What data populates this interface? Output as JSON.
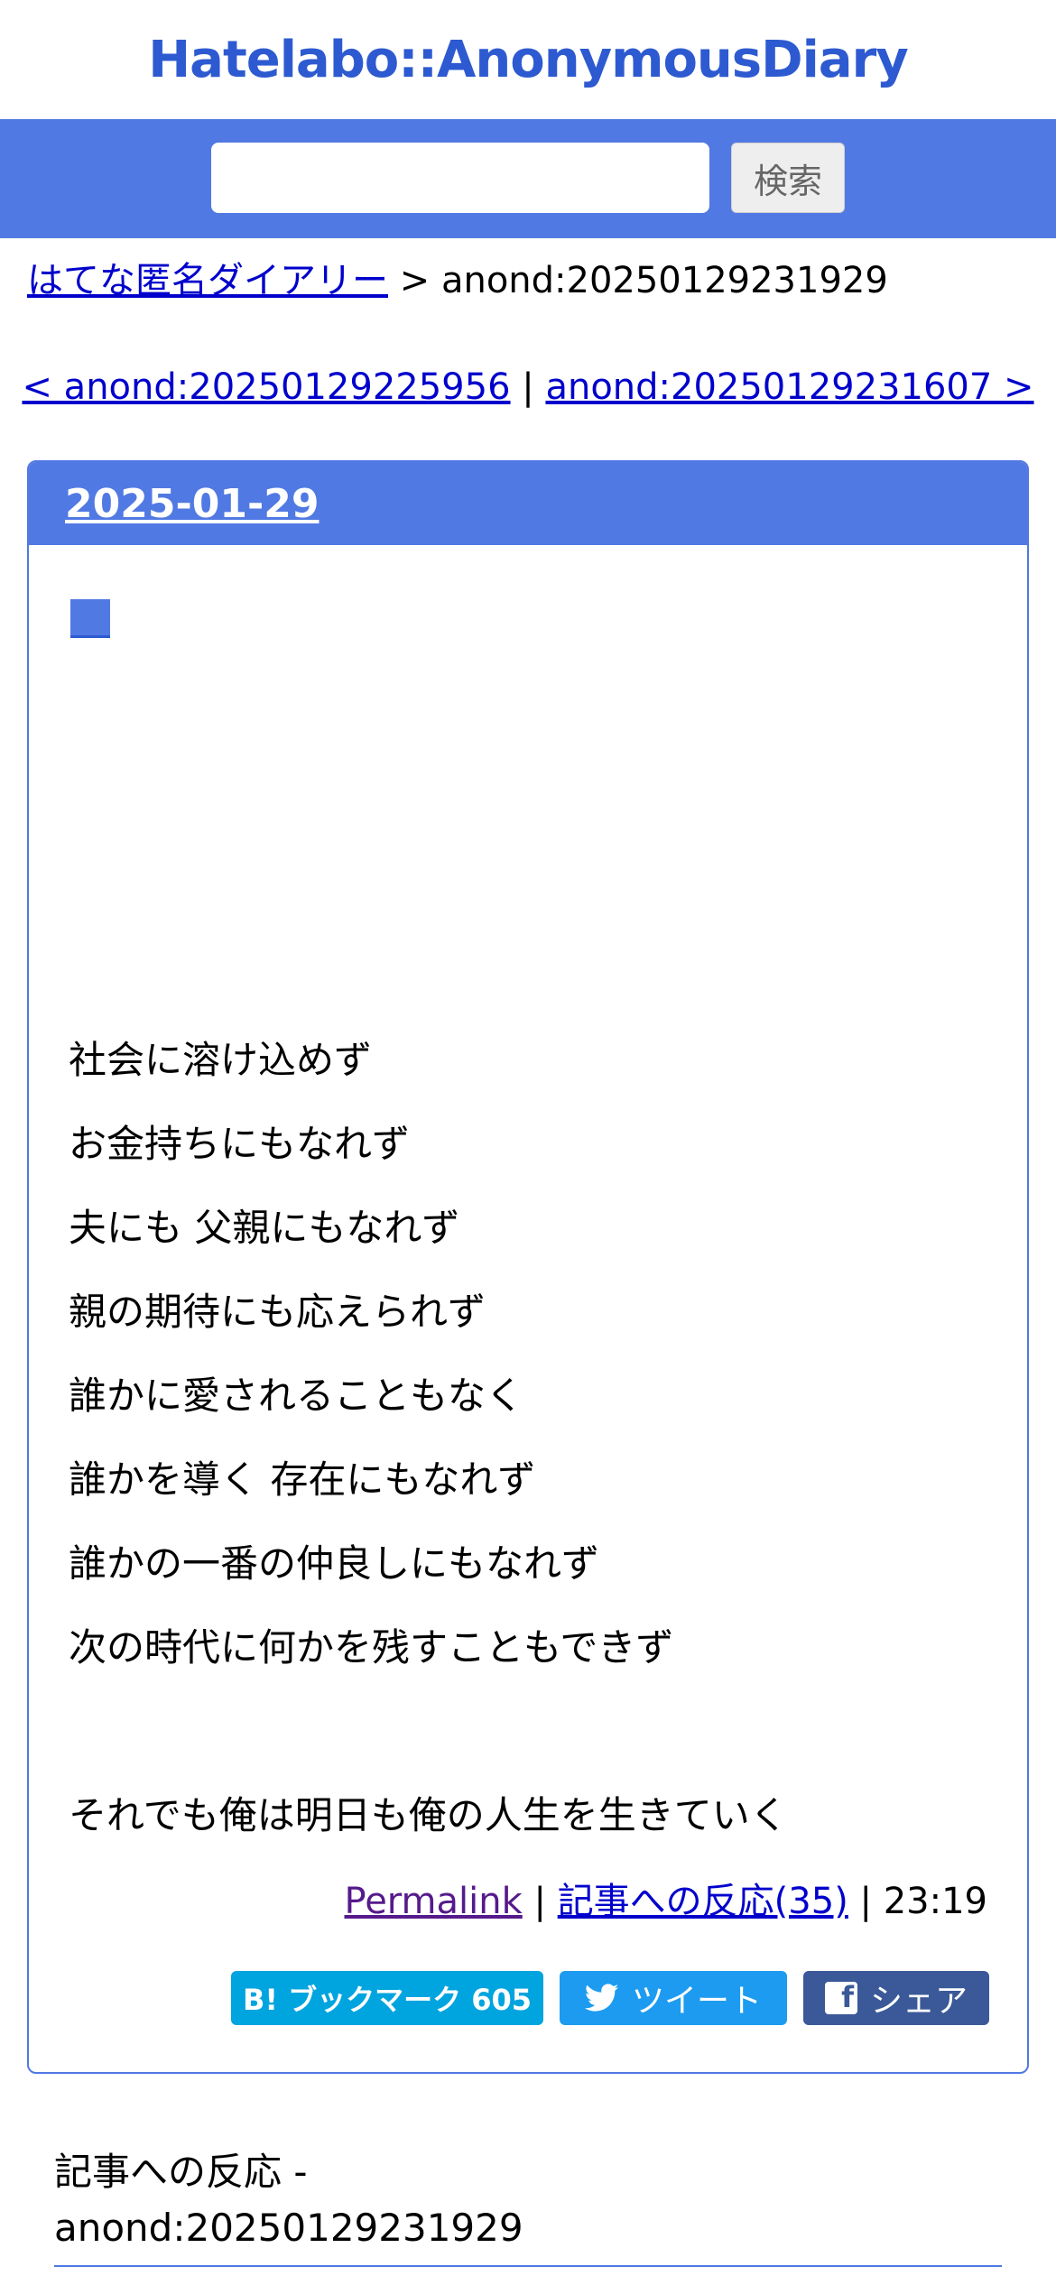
{
  "header": {
    "site_title": "Hatelabo::AnonymousDiary"
  },
  "search": {
    "value": "",
    "placeholder": "",
    "button_label": "検索"
  },
  "breadcrumb": {
    "home_label": "はてな匿名ダイアリー",
    "separator": ">",
    "current": "anond:20250129231929"
  },
  "pager": {
    "prev_label": "< anond:20250129225956",
    "divider": "|",
    "next_label": "anond:20250129231607 >"
  },
  "entry": {
    "date": "2025-01-29",
    "section_mark": "■",
    "lines": [
      "社会に溶け込めず",
      "お金持ちにもなれず",
      "夫にも 父親にもなれず",
      "親の期待にも応えられず",
      "誰かに愛されることもなく",
      "誰かを導く 存在にもなれず",
      "誰かの一番の仲良しにもなれず",
      "次の時代に何かを残すこともできず",
      "それでも俺は明日も俺の人生を生きていく"
    ],
    "footer": {
      "permalink_label": "Permalink",
      "divider": "|",
      "reactions_label": "記事への反応(35)",
      "time": "23:19"
    },
    "share": {
      "hatena_label": "B! ブックマーク 605",
      "tweet_label": "ツイート",
      "facebook_label": "シェア"
    }
  },
  "reactions": {
    "title_line1": "記事への反応 -",
    "title_line2": "anond:20250129231929"
  },
  "colors": {
    "accent": "#5179e3",
    "title_blue": "#2d5ad0",
    "hatena": "#00a4de",
    "twitter": "#1d9bf0",
    "facebook": "#3b5998"
  }
}
